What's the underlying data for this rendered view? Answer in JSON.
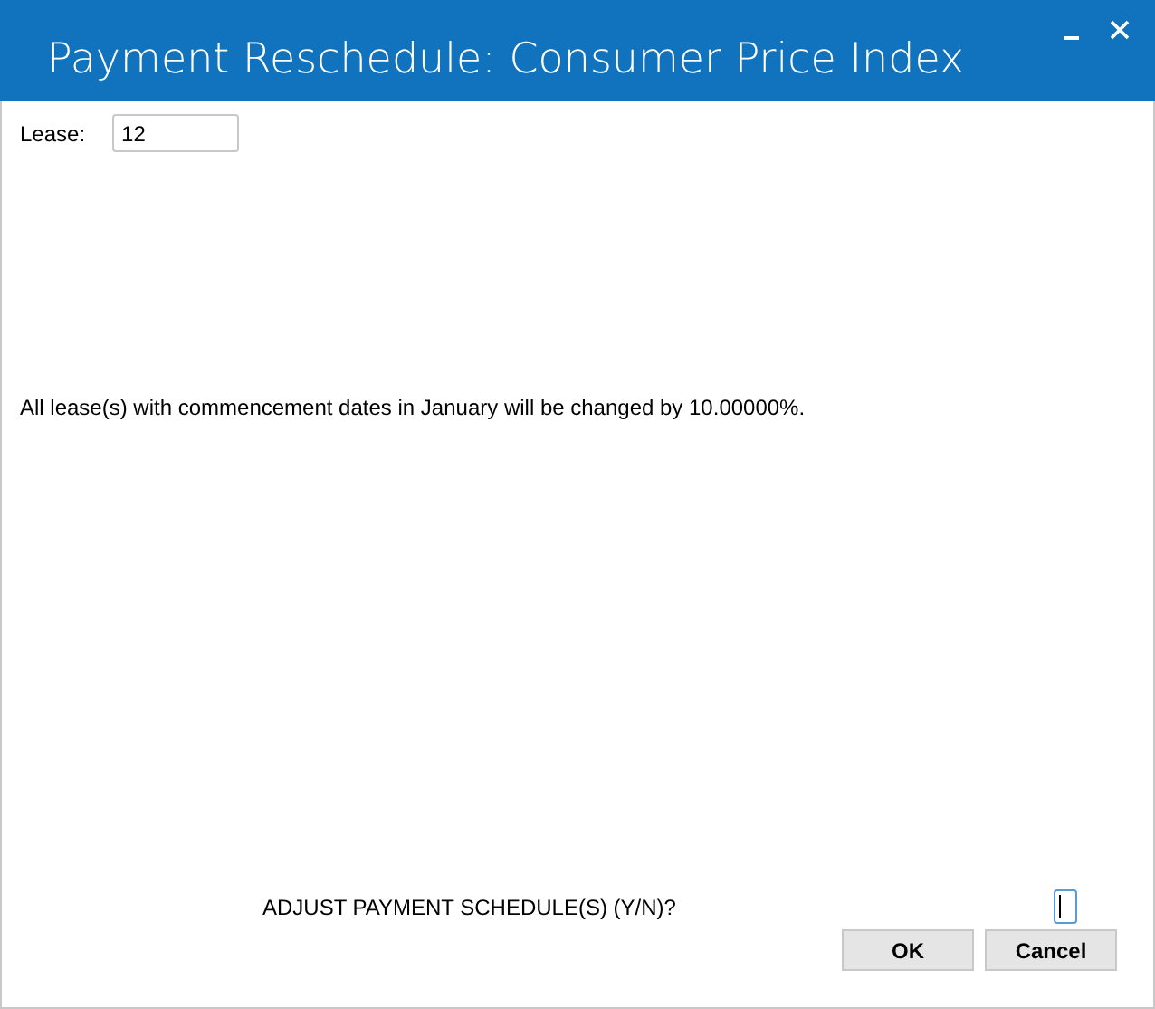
{
  "window": {
    "title": "Payment Reschedule: Consumer Price Index"
  },
  "lease": {
    "label": "Lease:",
    "value": "12"
  },
  "message": "All lease(s) with commencement dates in January will be changed by 10.00000%.",
  "prompt": {
    "label": "ADJUST PAYMENT SCHEDULE(S) (Y/N)?",
    "focused": true
  },
  "buttons": [
    "OK",
    "Cancel"
  ]
}
